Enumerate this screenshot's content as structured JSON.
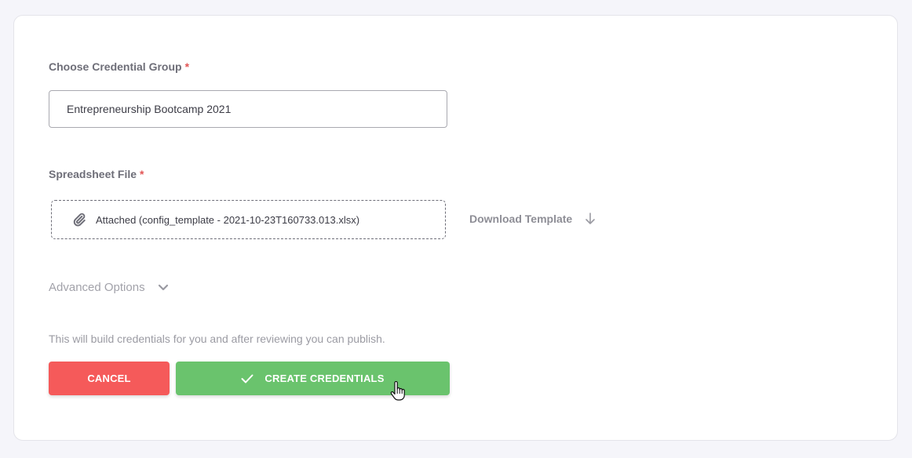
{
  "form": {
    "credential_group": {
      "label": "Choose Credential Group",
      "required_mark": "*",
      "value": "Entrepreneurship Bootcamp 2021"
    },
    "spreadsheet": {
      "label": "Spreadsheet File",
      "required_mark": "*",
      "attached_text": "Attached (config_template - 2021-10-23T160733.013.xlsx)",
      "icon": "paperclip-icon"
    },
    "download_template": {
      "label": "Download Template",
      "icon": "arrow-down-icon"
    },
    "advanced_options": {
      "label": "Advanced Options",
      "icon": "chevron-down-icon"
    },
    "info_text": "This will build credentials for you and after reviewing you can publish.",
    "actions": {
      "cancel_label": "CANCEL",
      "create_label": "CREATE CREDENTIALS",
      "create_icon": "check-icon"
    }
  },
  "colors": {
    "cancel": "#f55a5a",
    "create": "#6ac36d",
    "required": "#e25555",
    "page_bg": "#f5f5fa"
  }
}
